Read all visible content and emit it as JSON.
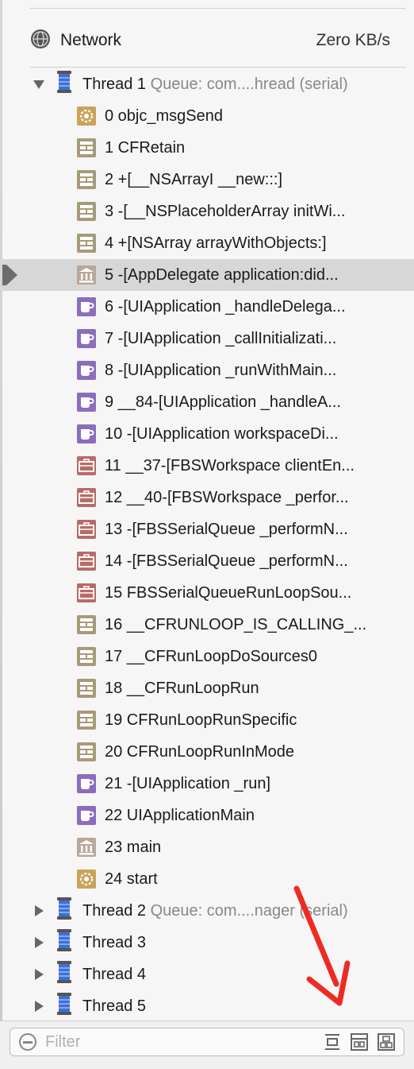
{
  "network": {
    "label": "Network",
    "value": "Zero KB/s"
  },
  "thread1": {
    "label": "Thread 1",
    "queue": "Queue: com....hread (serial)"
  },
  "frames": [
    {
      "label": "0 objc_msgSend",
      "icon": "gear-icon"
    },
    {
      "label": "1 CFRetain",
      "icon": "framework-icon"
    },
    {
      "label": "2 +[__NSArrayI __new:::]",
      "icon": "framework-icon"
    },
    {
      "label": "3 -[__NSPlaceholderArray initWi...",
      "icon": "framework-icon"
    },
    {
      "label": "4 +[NSArray arrayWithObjects:]",
      "icon": "framework-icon"
    },
    {
      "label": "5 -[AppDelegate application:did...",
      "icon": "user-code-icon"
    },
    {
      "label": "6 -[UIApplication _handleDelega...",
      "icon": "uikit-icon"
    },
    {
      "label": "7 -[UIApplication _callInitializati...",
      "icon": "uikit-icon"
    },
    {
      "label": "8 -[UIApplication _runWithMain...",
      "icon": "uikit-icon"
    },
    {
      "label": "9 __84-[UIApplication _handleA...",
      "icon": "uikit-icon"
    },
    {
      "label": "10 -[UIApplication workspaceDi...",
      "icon": "uikit-icon"
    },
    {
      "label": "11 __37-[FBSWorkspace clientEn...",
      "icon": "briefcase-icon"
    },
    {
      "label": "12 __40-[FBSWorkspace _perfor...",
      "icon": "briefcase-icon"
    },
    {
      "label": "13 -[FBSSerialQueue _performN...",
      "icon": "briefcase-icon"
    },
    {
      "label": "14 -[FBSSerialQueue _performN...",
      "icon": "briefcase-icon"
    },
    {
      "label": "15 FBSSerialQueueRunLoopSou...",
      "icon": "briefcase-icon"
    },
    {
      "label": "16 __CFRUNLOOP_IS_CALLING_...",
      "icon": "framework-icon"
    },
    {
      "label": "17 __CFRunLoopDoSources0",
      "icon": "framework-icon"
    },
    {
      "label": "18 __CFRunLoopRun",
      "icon": "framework-icon"
    },
    {
      "label": "19 CFRunLoopRunSpecific",
      "icon": "framework-icon"
    },
    {
      "label": "20 CFRunLoopRunInMode",
      "icon": "framework-icon"
    },
    {
      "label": "21 -[UIApplication _run]",
      "icon": "uikit-icon"
    },
    {
      "label": "22 UIApplicationMain",
      "icon": "uikit-icon"
    },
    {
      "label": "23 main",
      "icon": "user-code-icon"
    },
    {
      "label": "24 start",
      "icon": "gear-icon"
    }
  ],
  "threads": [
    {
      "label": "Thread 2",
      "queue": "Queue: com....nager (serial)"
    },
    {
      "label": "Thread 3",
      "queue": ""
    },
    {
      "label": "Thread 4",
      "queue": ""
    },
    {
      "label": "Thread 5",
      "queue": ""
    }
  ],
  "filter": {
    "placeholder": "Filter"
  },
  "colors": {
    "framework": "#a69a7a",
    "uikit": "#8c6dbb",
    "briefcase": "#b86b66",
    "gear": "#c9a35a",
    "thread": "#3d6fd8",
    "arrow": "#ee2b22"
  }
}
